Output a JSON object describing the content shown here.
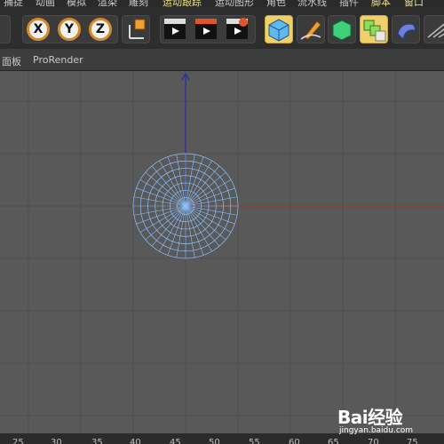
{
  "menubar": {
    "items": [
      {
        "label": "捕捉",
        "highlight": false
      },
      {
        "label": "动画",
        "highlight": false
      },
      {
        "label": "模拟",
        "highlight": false
      },
      {
        "label": "渲染",
        "highlight": false
      },
      {
        "label": "雕刻",
        "highlight": false
      },
      {
        "label": "运动跟踪",
        "highlight": true
      },
      {
        "label": "运动图形",
        "highlight": false
      },
      {
        "label": "角色",
        "highlight": false
      },
      {
        "label": "流水线",
        "highlight": false
      },
      {
        "label": "插件",
        "highlight": false
      },
      {
        "label": "脚本",
        "highlight": true
      },
      {
        "label": "窗口",
        "highlight": true
      }
    ]
  },
  "toolbar": {
    "axis_x": "X",
    "axis_y": "Y",
    "axis_z": "Z"
  },
  "panel": {
    "tabs": [
      "面板",
      "ProRender"
    ]
  },
  "viewport": {
    "background": "#595959",
    "grid_color": "#4f4f4f",
    "y_axis_color": "#2a2aa8",
    "x_axis_color": "#a82a2a",
    "mesh_color": "#8ec1ff",
    "object": "disc-wireframe"
  },
  "ruler": {
    "ticks": [
      "25",
      "30",
      "35",
      "40",
      "45",
      "50",
      "55",
      "60",
      "65",
      "70",
      "75"
    ]
  },
  "watermark": {
    "logo": "Bai经验",
    "url": "jingyan.baidu.com"
  }
}
